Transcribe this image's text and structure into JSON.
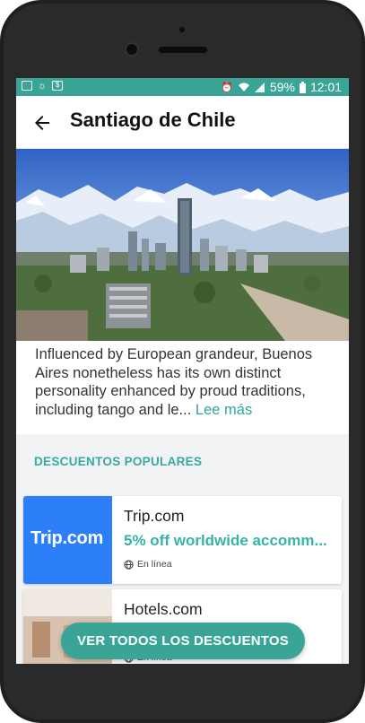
{
  "status_bar": {
    "battery_percent": "59%",
    "time": "12:01"
  },
  "header": {
    "title": "Santiago de Chile"
  },
  "description": {
    "text": "Influenced by European grandeur, Buenos Aires nonetheless has its own distinct personality enhanced by proud traditions, including tango and le...",
    "read_more": "Lee más"
  },
  "discounts": {
    "section_title": "DESCUENTOS POPULARES",
    "items": [
      {
        "logo_text": "Trip.com",
        "brand": "Trip.com",
        "offer": "5% off worldwide accomm...",
        "availability": "En línea"
      },
      {
        "brand": "Hotels.com",
        "availability": "En línea"
      }
    ]
  },
  "cta": {
    "label": "VER TODOS LOS DESCUENTOS"
  },
  "colors": {
    "accent": "#3aa596",
    "offer": "#37b3a6",
    "trip_blue": "#2d7ff9"
  },
  "icons": [
    "back-arrow-icon",
    "mail-icon",
    "weather-icon",
    "dollar-icon",
    "wifi-icon",
    "signal-icon",
    "battery-icon",
    "globe-icon"
  ]
}
